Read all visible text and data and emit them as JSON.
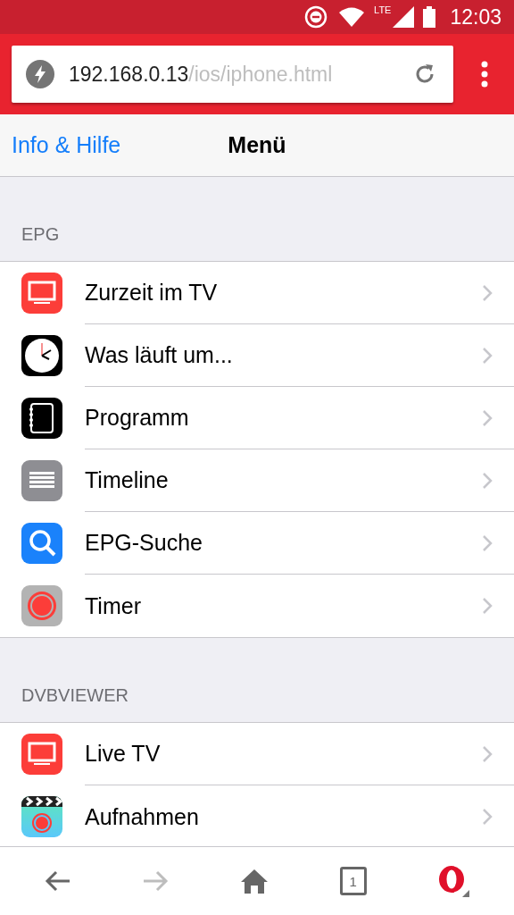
{
  "status_bar": {
    "network": "LTE",
    "time": "12:03"
  },
  "address_bar": {
    "host": "192.168.0.13",
    "path": "/ios/iphone.html"
  },
  "nav_bar": {
    "back_link": "Info & Hilfe",
    "title": "Menü"
  },
  "sections": [
    {
      "header": "EPG",
      "items": [
        {
          "label": "Zurzeit im TV",
          "kind": "tv"
        },
        {
          "label": "Was läuft um...",
          "kind": "clock"
        },
        {
          "label": "Programm",
          "kind": "notebook"
        },
        {
          "label": "Timeline",
          "kind": "timeline"
        },
        {
          "label": "EPG-Suche",
          "kind": "search"
        },
        {
          "label": "Timer",
          "kind": "record"
        }
      ]
    },
    {
      "header": "DVBVIEWER",
      "items": [
        {
          "label": "Live TV",
          "kind": "tv"
        },
        {
          "label": "Aufnahmen",
          "kind": "clapper"
        }
      ]
    }
  ],
  "bottom_bar": {
    "forward_disabled": true,
    "tab_count": "1"
  }
}
